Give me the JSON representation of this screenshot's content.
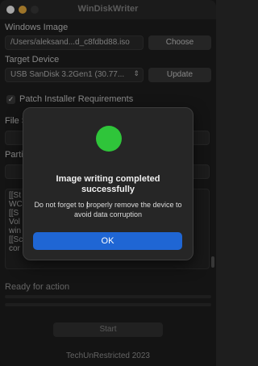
{
  "window": {
    "title": "WinDiskWriter"
  },
  "traffic_lights": {
    "close_color": "#ffffff",
    "min_color": "#f2b340",
    "max_color": "#3b3b3b"
  },
  "windows_image": {
    "label": "Windows Image",
    "path": "/Users/aleksand...d_c8fdbd88.iso",
    "button": "Choose"
  },
  "target_device": {
    "label": "Target Device",
    "selected": "USB SanDisk 3.2Gen1 (30.77...",
    "button": "Update"
  },
  "patch": {
    "label": "Patch Installer Requirements",
    "checked": true,
    "check_glyph": "✓"
  },
  "obscured_labels": {
    "file_system": "File S",
    "partition": "Partit"
  },
  "log_lines": [
    "[[St",
    "WC",
    "[[S",
    "Vol",
    "win",
    "[[Sc",
    "cor"
  ],
  "status": {
    "text": "Ready for action"
  },
  "start_button": {
    "label": "Start"
  },
  "footer": {
    "text": "TechUnRestricted 2023"
  },
  "dialog": {
    "status_color": "#2fc53a",
    "title": "Image writing completed successfully",
    "message": "Do not forget to properly remove the device to avoid data corruption",
    "ok_label": "OK",
    "accent": "#1f66d4"
  }
}
